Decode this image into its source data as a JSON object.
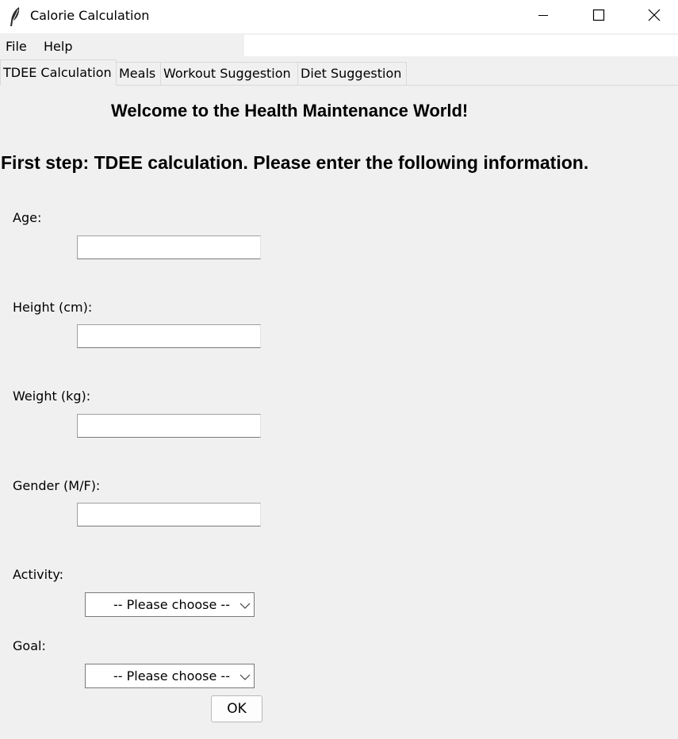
{
  "window": {
    "title": "Calorie Calculation",
    "icon": "feather-icon",
    "controls": [
      "minimize-icon",
      "maximize-icon",
      "close-icon"
    ]
  },
  "menu": {
    "file": "File",
    "help": "Help"
  },
  "tabs": [
    {
      "label": "TDEE Calculation",
      "active": true
    },
    {
      "label": "Meals",
      "active": false
    },
    {
      "label": "Workout Suggestion",
      "active": false
    },
    {
      "label": "Diet Suggestion",
      "active": false
    }
  ],
  "content": {
    "welcome": "Welcome to the Health Maintenance World!",
    "instruction": "First step: TDEE calculation. Please enter the following information.",
    "fields": {
      "age": {
        "label": "Age:",
        "value": ""
      },
      "height": {
        "label": "Height (cm):",
        "value": ""
      },
      "weight": {
        "label": "Weight (kg):",
        "value": ""
      },
      "gender": {
        "label": "Gender (M/F):",
        "value": ""
      }
    },
    "activity": {
      "label": "Activity:",
      "selected": "-- Please choose --"
    },
    "goal": {
      "label": "Goal:",
      "selected": "-- Please choose --"
    },
    "ok_label": "OK"
  }
}
